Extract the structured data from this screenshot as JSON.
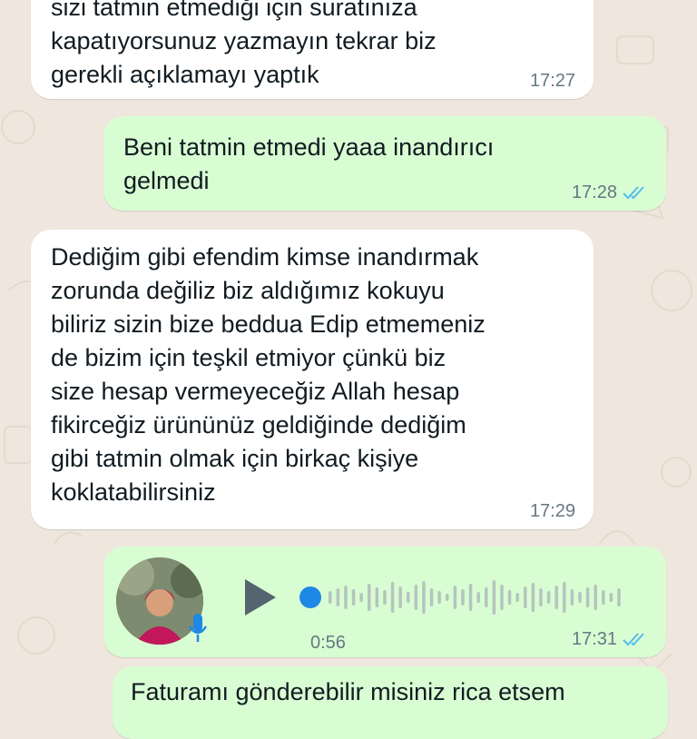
{
  "colors": {
    "background": "#efe7dd",
    "incoming_bubble": "#ffffff",
    "outgoing_bubble": "#d9fdd3",
    "read_ticks": "#53bdeb",
    "play_dot": "#1e88e5"
  },
  "messages": [
    {
      "direction": "in",
      "text": "sizi tatmin etmediği için suratınıza\nkapatıyorsunuz yazmayın tekrar biz\ngerekli açıklamayı yaptık",
      "time": "17:27"
    },
    {
      "direction": "out",
      "text": "Beni tatmin etmedi yaaa inandırıcı\ngelmedi",
      "time": "17:28",
      "status_icon": "double-check-read-icon"
    },
    {
      "direction": "in",
      "text": "Dediğim gibi efendim kimse inandırmak\nzorunda değiliz biz aldığımız kokuyu\nbiliriz sizin bize beddua Edip etmemeniz\nde bizim için teşkil etmiyor çünkü biz\nsize hesap vermeyeceğiz Allah hesap\nfikirceğiz ürününüz geldiğinde dediğim\ngibi tatmin olmak için birkaç kişiye\nkoklatabilirsiniz",
      "time": "17:29"
    },
    {
      "direction": "out",
      "type": "voice",
      "duration": "0:56",
      "time": "17:31",
      "status_icon": "double-check-read-icon",
      "icons": [
        "avatar",
        "microphone-icon",
        "play-icon"
      ]
    },
    {
      "direction": "out",
      "text": "Faturamı gönderebilir misiniz rica etsem",
      "time": ""
    }
  ]
}
